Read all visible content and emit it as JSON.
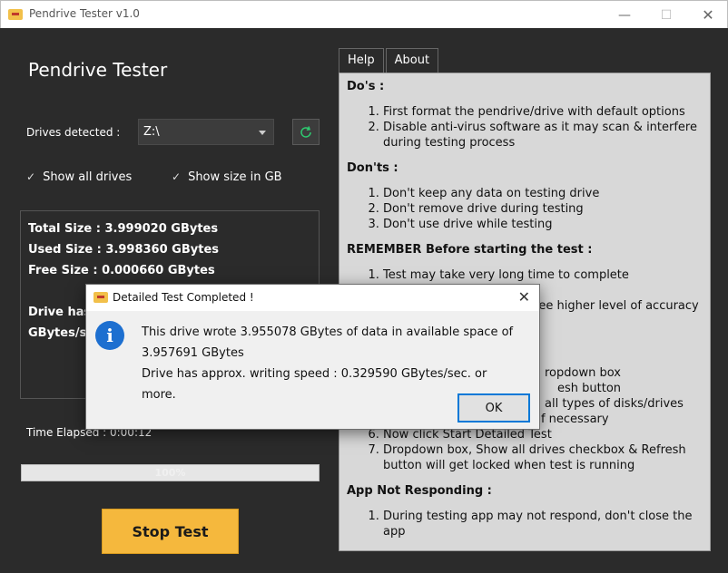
{
  "window": {
    "title": "Pendrive Tester v1.0",
    "minimize": "—",
    "maximize": "☐",
    "close": "✕"
  },
  "app": {
    "title": "Pendrive Tester",
    "drives_label": "Drives detected :",
    "drive_selected": "Z:\\",
    "show_all_drives": "Show all drives",
    "show_size_gb": "Show size in GB",
    "check_mark": "✓"
  },
  "info": {
    "total_size": "Total Size : 3.999020 GBytes",
    "used_size": "Used Size : 3.998360 GBytes",
    "free_size": "Free Size : 0.000660 GBytes",
    "drive_has_partial": "Drive has",
    "gbytes_partial": "GBytes/se"
  },
  "elapsed": "Time Elapsed : 0:00:12",
  "progress": {
    "label": "100%",
    "value": 1.0
  },
  "stop_button": "Stop Test",
  "tabs": [
    {
      "label": "Help"
    },
    {
      "label": "About"
    }
  ],
  "help": {
    "dos_title": "Do's :",
    "dos": [
      "First format the pendrive/drive with default options",
      "Disable anti-virus software as it may scan & interfere during testing process"
    ],
    "donts_title": "Don'ts :",
    "donts": [
      "Don't keep any data on testing drive",
      "Don't remove drive during testing",
      "Don't use drive while testing"
    ],
    "remember_title": "REMEMBER Before starting the test :",
    "remember": [
      "Test may take very long time to complete",
      "This test does not guarantee higher level of accuracy or"
    ],
    "steps": [
      "ropdown box",
      "esh button",
      "all types of disks/drives",
      "Click Show size in GBytes if necessary",
      "Now click Start Detailed Test",
      "Dropdown box, Show all drives checkbox & Refresh button will get locked when test is running"
    ],
    "not_responding_title": "App Not Responding :",
    "not_responding": [
      "During testing app may not respond, don't close the app"
    ]
  },
  "dialog": {
    "title": "Detailed Test Completed !",
    "close": "✕",
    "icon": "i",
    "line1": "This drive wrote 3.955078 GBytes of data in available space of",
    "line2": "3.957691 GBytes",
    "line3": "Drive has approx. writing speed : 0.329590 GBytes/sec. or more.",
    "ok": "OK"
  }
}
